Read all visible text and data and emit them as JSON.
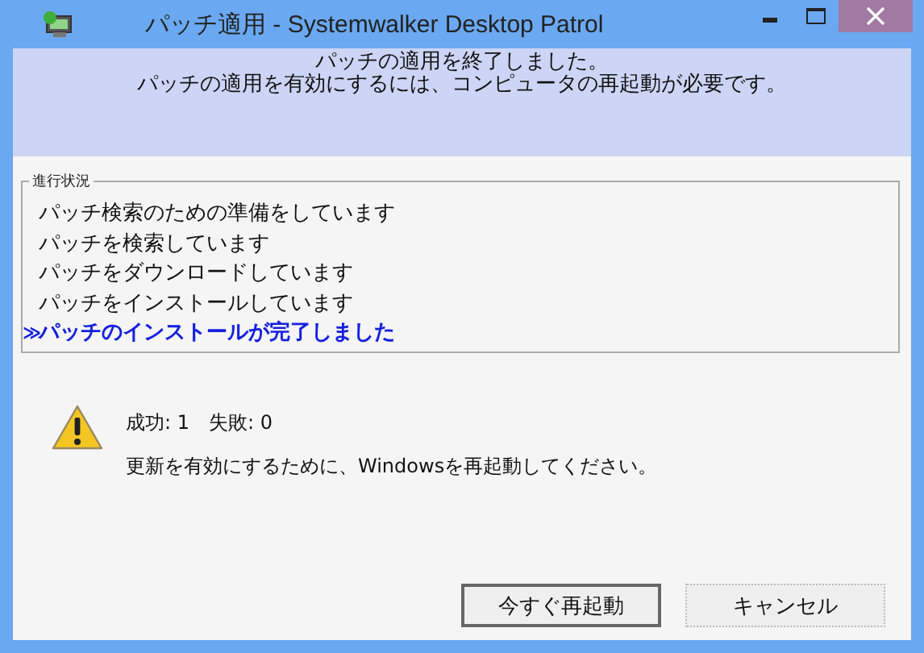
{
  "window": {
    "title": "パッチ適用 - Systemwalker Desktop Patrol"
  },
  "header": {
    "lines": [
      "パッチの適用を終了しました。",
      "パッチの適用を有効にするには、コンピュータの再起動が必要です。"
    ]
  },
  "progress": {
    "label": "進行状況",
    "marker": "≫",
    "steps": [
      {
        "text": "パッチ検索のための準備をしています",
        "selected": false
      },
      {
        "text": "パッチを検索しています",
        "selected": false
      },
      {
        "text": "パッチをダウンロードしています",
        "selected": false
      },
      {
        "text": "パッチをインストールしています",
        "selected": false
      },
      {
        "text": "パッチのインストールが完了しました",
        "selected": true
      }
    ]
  },
  "result": {
    "counts": "成功: 1　失敗: 0",
    "message": "更新を有効にするために、Windowsを再起動してください。"
  },
  "buttons": [
    {
      "label": "今すぐ再起動",
      "selected": true
    },
    {
      "label": "キャンセル",
      "selected": false
    }
  ]
}
